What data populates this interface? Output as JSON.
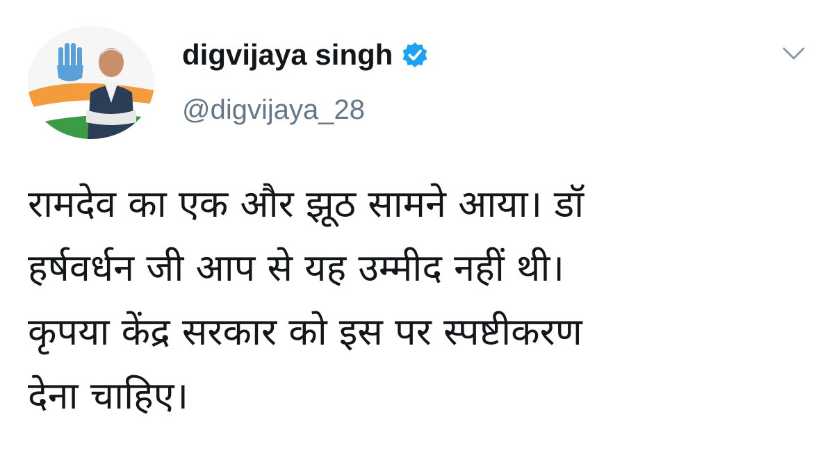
{
  "tweet": {
    "display_name": "digvijaya singh",
    "handle": "@digvijaya_28",
    "verified": true,
    "text_lines": [
      "रामदेव का एक और झूठ सामने आया। डॉ",
      "हर्षवर्धन जी आप से यह उम्मीद नहीं थी।",
      "कृपया केंद्र सरकार को इस पर स्पष्टीकरण",
      "देना चाहिए।"
    ]
  },
  "colors": {
    "verified_blue": "#1da1f2",
    "text": "#14171a",
    "secondary_text": "#657786",
    "chevron": "#8899a6"
  },
  "icons": {
    "verified": "verified-badge-icon",
    "menu": "chevron-down-icon"
  }
}
